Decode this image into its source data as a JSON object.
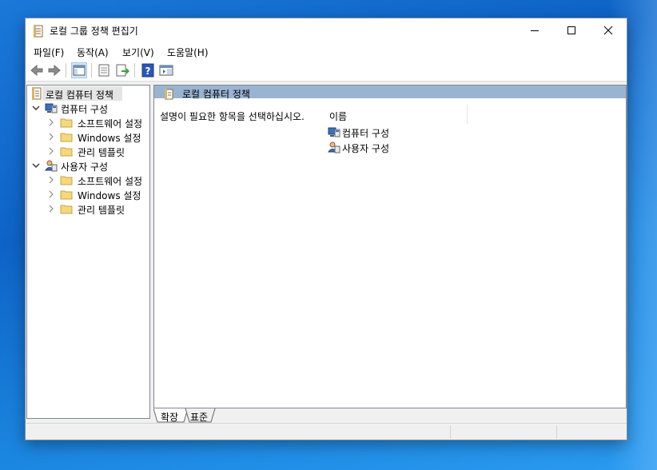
{
  "window": {
    "title": "로컬 그룹 정책 편집기"
  },
  "menu": {
    "items": [
      "파일(F)",
      "동작(A)",
      "보기(V)",
      "도움말(H)"
    ]
  },
  "toolbar": {
    "buttons": [
      "back-icon",
      "forward-icon",
      "show-hide-console-tree-icon",
      "properties-icon",
      "export-list-icon",
      "help-icon",
      "show-hide-action-pane-icon"
    ]
  },
  "tree": {
    "root": "로컬 컴퓨터 정책",
    "computer": "컴퓨터 구성",
    "computer_children": [
      "소프트웨어 설정",
      "Windows 설정",
      "관리 템플릿"
    ],
    "user": "사용자 구성",
    "user_children": [
      "소프트웨어 설정",
      "Windows 설정",
      "관리 템플릿"
    ]
  },
  "details": {
    "header": "로컬 컴퓨터 정책",
    "description": "설명이 필요한 항목을 선택하십시오.",
    "column_name": "이름",
    "rows": [
      "컴퓨터 구성",
      "사용자 구성"
    ]
  },
  "tabs": [
    "확장",
    "표준"
  ],
  "colors": {
    "header_bg": "#99b4d1",
    "selection_bg": "#e5e5e5",
    "folder": "#f5d77e"
  }
}
